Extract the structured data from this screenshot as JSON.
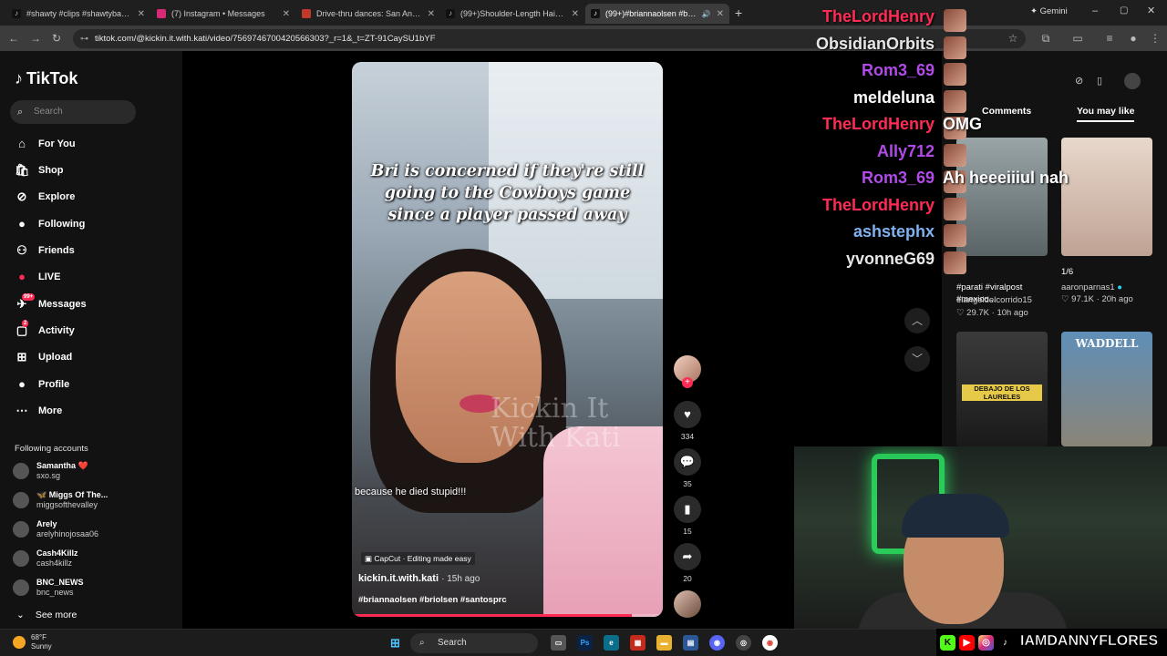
{
  "tabs": [
    {
      "title": "#shawty #clips #shawtybae #p",
      "icon": "tiktok-icon",
      "active": false
    },
    {
      "title": "(7) Instagram • Messages",
      "icon": "instagram-icon",
      "active": false
    },
    {
      "title": "Drive-thru dances: San Antonio",
      "icon": "news-icon",
      "active": false
    },
    {
      "title": "(99+)Shoulder-Length Hair Sty",
      "icon": "tiktok-icon",
      "active": false
    },
    {
      "title": "(99+)#briannaolsen #brio",
      "icon": "tiktok-icon",
      "active": true
    }
  ],
  "browser": {
    "url": "tiktok.com/@kickin.it.with.kati/video/7569746700420566303?_r=1&_t=ZT-91CaySU1bYF",
    "gemini_label": "Gemini"
  },
  "sidebar": {
    "logo": "TikTok",
    "search_placeholder": "Search",
    "nav": [
      {
        "label": "For You",
        "icon": "home-icon"
      },
      {
        "label": "Shop",
        "icon": "shop-icon"
      },
      {
        "label": "Explore",
        "icon": "compass-icon"
      },
      {
        "label": "Following",
        "icon": "following-avatar-icon"
      },
      {
        "label": "Friends",
        "icon": "friends-icon"
      },
      {
        "label": "LIVE",
        "icon": "live-icon"
      },
      {
        "label": "Messages",
        "icon": "messages-icon",
        "badge": "99+"
      },
      {
        "label": "Activity",
        "icon": "activity-icon",
        "badge": "2"
      },
      {
        "label": "Upload",
        "icon": "upload-icon"
      },
      {
        "label": "Profile",
        "icon": "profile-icon"
      },
      {
        "label": "More",
        "icon": "more-icon"
      }
    ],
    "following_heading": "Following accounts",
    "accounts": [
      {
        "name": "Samantha ❤️",
        "handle": "sxo.sg"
      },
      {
        "name": "🦋 Miggs Of The...",
        "handle": "miggsofthevalley"
      },
      {
        "name": "Arely",
        "handle": "arelyhinojosaa06"
      },
      {
        "name": "Cash4Killz",
        "handle": "cash4killz"
      },
      {
        "name": "BNC_NEWS",
        "handle": "bnc_news"
      }
    ],
    "see_more": "See more"
  },
  "video": {
    "caption": "Bri is concerned if they're still going to the Cowboys game since a player passed away",
    "subtitle": "because he died stupid!!!",
    "watermark": "Kickin It With Kati",
    "capcut_label": "CapCut · Editing made easy",
    "author": "kickin.it.with.kati",
    "posted": "· 15h ago",
    "tags": "#briannaolsen #briolsen #santosprc",
    "progress": 0.9
  },
  "actions": {
    "likes": "334",
    "comments": "35",
    "saves": "15",
    "shares": "20"
  },
  "right_panel": {
    "tab_comments": "Comments",
    "tab_you_may_like": "You may like",
    "videos": [
      {
        "caption": "#parati #viralpost #mexico...",
        "author": "elangeldelcorrido15",
        "likes": "29.7K",
        "age": "10h ago"
      },
      {
        "caption": "1/6",
        "author": "aaronparnas1",
        "likes": "97.1K",
        "age": "20h ago"
      },
      {
        "caption": "",
        "author": "",
        "likes": "",
        "age": ""
      },
      {
        "caption": "",
        "author": "",
        "likes": "",
        "age": ""
      }
    ],
    "thumb_texts": [
      "DEBAJO DE LOS LAURELES",
      "WADDELL"
    ]
  },
  "chat": [
    {
      "user": "TheLordHenry",
      "color": "#fe2c55",
      "msg": ""
    },
    {
      "user": "ObsidianOrbits",
      "color": "#e6e6e6",
      "msg": ""
    },
    {
      "user": "Rom3_69",
      "color": "#b04be8",
      "msg": ""
    },
    {
      "user": "meldeluna",
      "color": "#ffffff",
      "msg": ""
    },
    {
      "user": "TheLordHenry",
      "color": "#fe2c55",
      "msg": "OMG"
    },
    {
      "user": "Ally712",
      "color": "#b04be8",
      "msg": ""
    },
    {
      "user": "Rom3_69",
      "color": "#b04be8",
      "msg": "Ah heeeiiiul nah"
    },
    {
      "user": "TheLordHenry",
      "color": "#fe2c55",
      "msg": ""
    },
    {
      "user": "ashstephx",
      "color": "#7fb2f0",
      "msg": ""
    },
    {
      "user": "yvonneG69",
      "color": "#e6e6e6",
      "msg": ""
    }
  ],
  "stream": {
    "handle": "IAMDANNYFLORES"
  },
  "taskbar": {
    "temp": "68°F",
    "condition": "Sunny",
    "search": "Search"
  }
}
